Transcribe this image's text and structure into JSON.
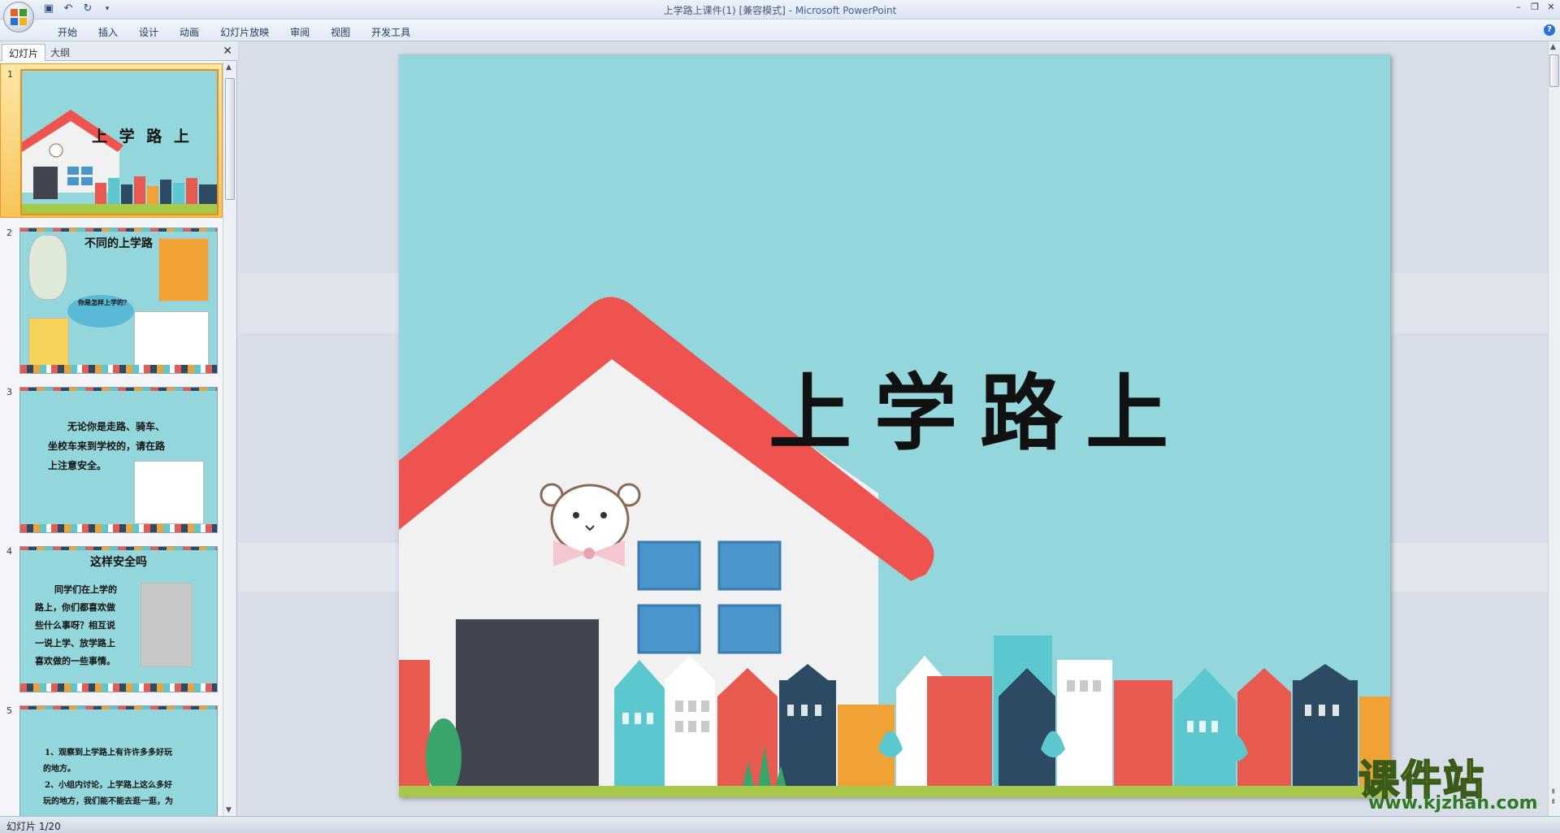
{
  "window": {
    "title": "上学路上课件(1) [兼容模式] - ",
    "app_name": "Microsoft PowerPoint"
  },
  "ribbon": {
    "tabs": [
      "开始",
      "插入",
      "设计",
      "动画",
      "幻灯片放映",
      "审阅",
      "视图",
      "开发工具"
    ]
  },
  "left_pane": {
    "tab_slides": "幻灯片",
    "tab_outline": "大纲",
    "close": "✕"
  },
  "thumbnails": [
    {
      "num": "1",
      "title": "上 学 路 上"
    },
    {
      "num": "2",
      "title": "不同的上学路",
      "bubble": "你是怎样上学的？"
    },
    {
      "num": "3",
      "lines": [
        "无论你是走路、骑车、",
        "坐校车来到学校的，请在路",
        "上注意安全。"
      ]
    },
    {
      "num": "4",
      "title": "这样安全吗",
      "lines": [
        "同学们在上学的",
        "路上，你们都喜欢做",
        "些什么事呀？相互说",
        "一说上学、放学路上",
        "喜欢做的一些事情。"
      ]
    },
    {
      "num": "5",
      "lines": [
        "1、观察到上学路上有许许多多好玩",
        "的地方。",
        "2、小组内讨论，上学路上这么多好",
        "玩的地方，我们能不能去逛一逛，为"
      ]
    }
  ],
  "slide": {
    "title": "上学路上"
  },
  "status": {
    "text": "幻灯片 1/20"
  },
  "watermark": {
    "main": "课件站",
    "sub": "www.kjzhan.com"
  },
  "colors": {
    "slide_bg": "#93d7dd",
    "roof": "#ee5350",
    "house": "#f1f1f1",
    "door": "#40454f",
    "window": "#4a95cc"
  }
}
